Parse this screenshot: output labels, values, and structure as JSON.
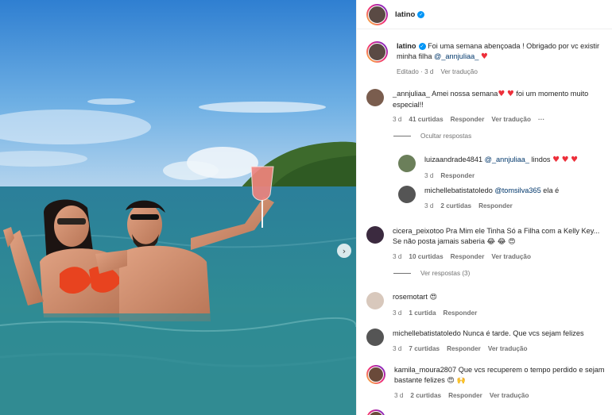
{
  "post": {
    "author": "latino",
    "caption": "Foi uma semana abençoada ! Obrigado por vc existir minha filha",
    "caption_mention": "@_annjuliaa_",
    "caption_edited": "Editado",
    "caption_time": "3 d",
    "translate_label": "Ver tradução"
  },
  "colors": {
    "accent": "#0095f6",
    "heart": "#ed2f3a",
    "muted": "#737373"
  },
  "icons": {
    "verified": "verified-badge-icon",
    "next": "chevron-right-icon",
    "more": "more-horizontal-icon",
    "like": "heart-outline-icon"
  },
  "comments": [
    {
      "user": "_annjuliaa_",
      "text": "Amei nossa semana",
      "text2": "foi um momento muito especial!!",
      "time": "3 d",
      "likes": "41 curtidas",
      "reply": "Responder",
      "translate": "Ver tradução",
      "more": "···",
      "hide_replies": "Ocultar respostas"
    },
    {
      "user": "luizaandrade4841",
      "mention": "@_annjuliaa_",
      "text": "lindos",
      "time": "3 d",
      "reply": "Responder"
    },
    {
      "user": "michellebatistatoledo",
      "mention": "@tomsilva365",
      "text": "ela é",
      "time": "3 d",
      "likes": "2 curtidas",
      "reply": "Responder"
    },
    {
      "user": "cicera_peixotoo",
      "text": "Pra Mim ele Tinha Só a Filha com a Kelly Key...",
      "text2": "Se não posta jamais saberia",
      "time": "3 d",
      "likes": "10 curtidas",
      "reply": "Responder",
      "translate": "Ver tradução",
      "view_replies": "Ver respostas (3)"
    },
    {
      "user": "rosemotart",
      "text": "",
      "time": "3 d",
      "likes": "1 curtida",
      "reply": "Responder"
    },
    {
      "user": "michellebatistatoledo",
      "text": "Nunca é tarde. Que vcs sejam felizes",
      "time": "3 d",
      "likes": "7 curtidas",
      "reply": "Responder",
      "translate": "Ver tradução"
    },
    {
      "user": "kamila_moura2807",
      "text": "Que vcs recuperem o tempo perdido e",
      "text2": "sejam bastante felizes",
      "time": "3 d",
      "likes": "2 curtidas",
      "reply": "Responder",
      "translate": "Ver tradução"
    }
  ]
}
